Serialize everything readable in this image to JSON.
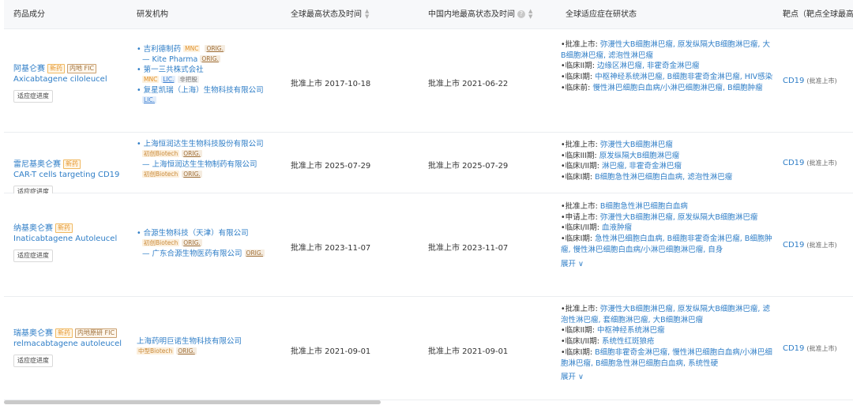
{
  "header": {
    "col_drug": "药品成分",
    "col_org": "研发机构",
    "col_global": "全球最高状态及时间",
    "col_china": "中国内地最高状态及时间",
    "col_indication": "全球适应症在研状态",
    "col_target": "靶点（靶点全球最高"
  },
  "progress_btn_label": "适应症进度",
  "expand_label": "展开 ∨",
  "rows": [
    {
      "drug_cn": "阿基仑赛",
      "tags": [
        "新药",
        "内地 FIC"
      ],
      "drug_en": "Axicabtagene ciloleucel",
      "orgs": [
        {
          "prefix": "•",
          "name": "吉利德制药",
          "badges": [
            "MNC",
            "ORIG."
          ],
          "inline": true
        },
        {
          "prefix": "—",
          "name": "Kite Pharma",
          "badges": [
            "ORIG."
          ],
          "inline": true,
          "sub": true
        },
        {
          "prefix": "•",
          "name": "第一三共株式会社",
          "badges": [],
          "inline": true
        },
        {
          "prefix": "",
          "name": "",
          "badges": [
            "MNC",
            "LIC.",
            "非把股"
          ],
          "inline": false
        },
        {
          "prefix": "•",
          "name": "复星凯瑞（上海）生物科技有限公司",
          "badges": [],
          "inline": true
        },
        {
          "prefix": "",
          "name": "",
          "badges": [
            "LIC."
          ],
          "inline": false
        }
      ],
      "global": "批准上市 2017-10-18",
      "china": "批准上市 2021-06-22",
      "indications": [
        {
          "stage": "•批准上市:",
          "text": "弥漫性大B细胞淋巴瘤, 原发纵隔大B细胞淋巴瘤, 大B细胞淋巴瘤, 滤泡性淋巴瘤"
        },
        {
          "stage": "•临床II期:",
          "text": "边缘区淋巴瘤, 非霍奇金淋巴瘤"
        },
        {
          "stage": "•临床I期:",
          "text": "中枢神经系统淋巴瘤, B细胞非霍奇金淋巴瘤, HIV感染"
        },
        {
          "stage": "•临床前:",
          "text": "慢性淋巴细胞白血病/小淋巴细胞淋巴瘤, B细胞肿瘤"
        }
      ],
      "expand": false,
      "target": "CD19",
      "target_note": "(批准上市)"
    },
    {
      "drug_cn": "雷尼基奥仑赛",
      "tags": [
        "新药"
      ],
      "drug_en": "CAR-T cells targeting CD19",
      "orgs": [
        {
          "prefix": "•",
          "name": "上海恒润达生生物科技股份有限公司",
          "badges": [],
          "inline": true
        },
        {
          "prefix": "",
          "name": "",
          "badges": [
            "初创Biotech",
            "ORIG."
          ],
          "inline": false
        },
        {
          "prefix": "—",
          "name": "上海恒润达生生物制药有限公司",
          "badges": [],
          "inline": true,
          "sub": true
        },
        {
          "prefix": "",
          "name": "",
          "badges": [
            "初创Biotech",
            "ORIG."
          ],
          "inline": false
        }
      ],
      "global": "批准上市 2025-07-29",
      "china": "批准上市 2025-07-29",
      "indications": [
        {
          "stage": "•批准上市:",
          "text": "弥漫性大B细胞淋巴瘤"
        },
        {
          "stage": "•临床III期:",
          "text": "原发纵隔大B细胞淋巴瘤"
        },
        {
          "stage": "•临床I/II期:",
          "text": "淋巴瘤, 非霍奇金淋巴瘤"
        },
        {
          "stage": "•临床I期:",
          "text": "B细胞急性淋巴细胞白血病, 滤泡性淋巴瘤"
        }
      ],
      "expand": false,
      "target": "CD19",
      "target_note": "(批准上市)"
    },
    {
      "drug_cn": "纳基奥仑赛",
      "tags": [
        "新药"
      ],
      "drug_en": "Inaticabtagene Autoleucel",
      "orgs": [
        {
          "prefix": "•",
          "name": "合源生物科技（天津）有限公司",
          "badges": [],
          "inline": true
        },
        {
          "prefix": "",
          "name": "",
          "badges": [
            "初创Biotech",
            "ORIG."
          ],
          "inline": false
        },
        {
          "prefix": "—",
          "name": "广东合源生物医药有限公司",
          "badges": [
            "ORIG."
          ],
          "inline": true,
          "sub": true
        }
      ],
      "global": "批准上市 2023-11-07",
      "china": "批准上市 2023-11-07",
      "indications": [
        {
          "stage": "•批准上市:",
          "text": "B细胞急性淋巴细胞白血病"
        },
        {
          "stage": "•申请上市:",
          "text": "弥漫性大B细胞淋巴瘤, 原发纵隔大B细胞淋巴瘤"
        },
        {
          "stage": "•临床I/II期:",
          "text": "血液肿瘤"
        },
        {
          "stage": "•临床I期:",
          "text": "急性淋巴细胞白血病, B细胞非霍奇金淋巴瘤, B细胞肿瘤, 慢性淋巴细胞白血病/小淋巴细胞淋巴瘤, 自身"
        }
      ],
      "expand": true,
      "target": "CD19",
      "target_note": "(批准上市)"
    },
    {
      "drug_cn": "瑞基奥仑赛",
      "tags": [
        "新药",
        "内地原研 FIC"
      ],
      "drug_en": "relmacabtagene autoleucel",
      "orgs": [
        {
          "prefix": "",
          "name": "上海药明巨诺生物科技有限公司",
          "badges": [],
          "inline": true
        },
        {
          "prefix": "",
          "name": "",
          "badges": [
            "中型Biotech",
            "ORIG."
          ],
          "inline": false,
          "nopad": true
        }
      ],
      "global": "批准上市 2021-09-01",
      "china": "批准上市 2021-09-01",
      "indications": [
        {
          "stage": "•批准上市:",
          "text": "弥漫性大B细胞淋巴瘤, 原发纵隔大B细胞淋巴瘤, 滤泡性淋巴瘤, 套细胞淋巴瘤, 大B细胞淋巴瘤"
        },
        {
          "stage": "•临床II期:",
          "text": "中枢神经系统淋巴瘤"
        },
        {
          "stage": "•临床I/II期:",
          "text": "系统性红斑狼疮"
        },
        {
          "stage": "•临床I期:",
          "text": "B细胞非霍奇金淋巴瘤, 慢性淋巴细胞白血病/小淋巴细胞淋巴瘤, B细胞急性淋巴细胞白血病, 系统性硬"
        }
      ],
      "expand": true,
      "target": "CD19",
      "target_note": "(批准上市)"
    }
  ]
}
